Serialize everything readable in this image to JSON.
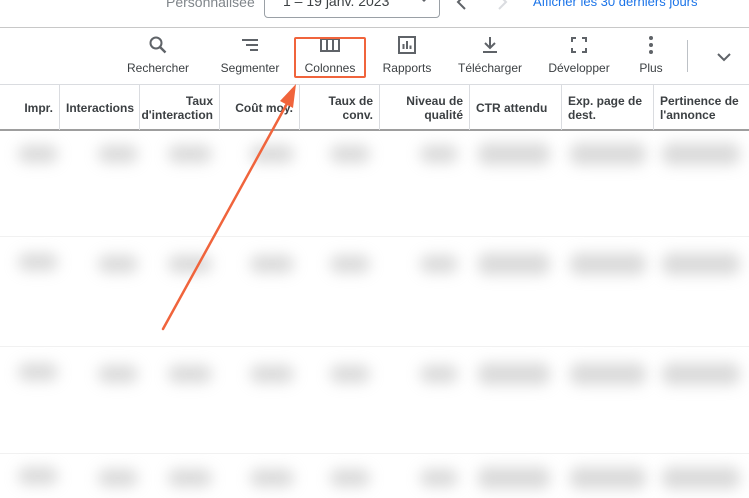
{
  "datebar": {
    "label": "Personnalisée",
    "range": "1 – 19 janv. 2023",
    "last30": "Afficher les 30 derniers jours"
  },
  "toolbar": {
    "items": [
      {
        "label": "Rechercher",
        "icon": "search-icon"
      },
      {
        "label": "Segmenter",
        "icon": "segment-icon"
      },
      {
        "label": "Colonnes",
        "icon": "columns-icon"
      },
      {
        "label": "Rapports",
        "icon": "reports-icon"
      },
      {
        "label": "Télécharger",
        "icon": "download-icon"
      },
      {
        "label": "Développer",
        "icon": "expand-icon"
      },
      {
        "label": "Plus",
        "icon": "more-vert-icon"
      }
    ]
  },
  "table": {
    "headers": [
      "Impr.",
      "Interactions",
      "Taux\nd'interaction",
      "Coût moy.",
      "Taux de\nconv.",
      "Niveau de\nqualité",
      "CTR attendu",
      "Exp. page de\ndest.",
      "Pertinence de\nl'annonce"
    ]
  },
  "colors": {
    "highlight": "#f0643c",
    "link": "#1a73e8"
  }
}
